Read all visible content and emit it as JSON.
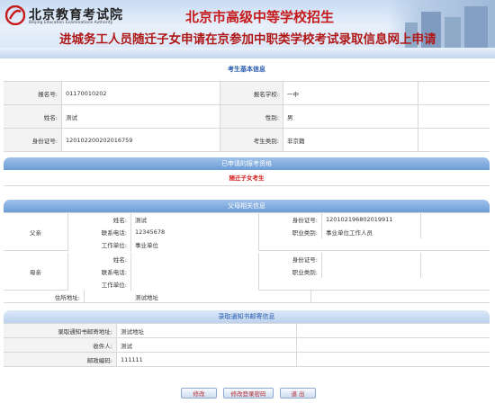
{
  "header": {
    "logo_cn": "北京教育考试院",
    "logo_en": "Beijing Education Examinations Authority",
    "title_main": "北京市高级中等学校招生",
    "title_sub": "进城务工人员随迁子女申请在京参加中职类学校考试录取信息网上申请"
  },
  "basic": {
    "title": "考生基本信息",
    "reg_no_label": "报名号:",
    "reg_no": "01170010202",
    "school_label": "报名学校:",
    "school": "一中",
    "name_label": "姓名:",
    "name": "测试",
    "gender_label": "性别:",
    "gender": "男",
    "id_label": "身份证号:",
    "id": "120102200202016759",
    "category_label": "考生类别:",
    "category": "非京籍"
  },
  "qualification": {
    "title": "已申请的报考资格",
    "value": "随迁子女考生"
  },
  "parents": {
    "title": "父母相关信息",
    "father_label": "父亲",
    "mother_label": "母亲",
    "name_label": "姓名:",
    "id_label": "身份证号:",
    "phone_label": "联系电话:",
    "job_label": "职业类别:",
    "work_label": "工作单位:",
    "father_name": "测试",
    "father_id": "120102196802019911",
    "father_phone": "12345678",
    "father_job": "事业单位工作人员",
    "father_work": "事业单位",
    "mother_name": "",
    "mother_id": "",
    "mother_phone": "",
    "mother_job": "",
    "mother_work": "",
    "address_label": "住所地址:",
    "address": "测试地址"
  },
  "mail": {
    "title": "录取通知书邮寄信息",
    "addr_label": "录取通知书邮寄地址:",
    "addr": "测试地址",
    "recipient_label": "收件人:",
    "recipient": "测试",
    "zip_label": "邮政编码:",
    "zip": "111111"
  },
  "buttons": {
    "edit": "修改",
    "change_password": "修改登录密码",
    "logout": "退 出"
  },
  "colors": {
    "title_red": "#c61a1a",
    "section_blue": "#2a5db0",
    "accent_red": "#d41a1a"
  }
}
